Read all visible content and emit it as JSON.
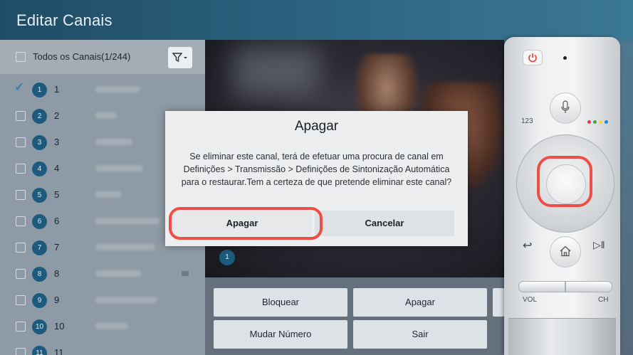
{
  "header": {
    "title": "Editar Canais"
  },
  "channel_list": {
    "all_label": "Todos os Canais(1/244)",
    "filter_icon": "filter-icon",
    "rows": [
      {
        "number": "1",
        "checked": true
      },
      {
        "number": "2",
        "checked": false
      },
      {
        "number": "3",
        "checked": false
      },
      {
        "number": "4",
        "checked": false
      },
      {
        "number": "5",
        "checked": false
      },
      {
        "number": "6",
        "checked": false
      },
      {
        "number": "7",
        "checked": false
      },
      {
        "number": "8",
        "checked": false
      },
      {
        "number": "9",
        "checked": false
      },
      {
        "number": "10",
        "checked": false
      },
      {
        "number": "11",
        "checked": false
      }
    ]
  },
  "video": {
    "channel_badge": "1"
  },
  "actions": {
    "bloquear": "Bloquear",
    "apagar": "Apagar",
    "mudar_numero": "Mudar Número",
    "sair": "Sair"
  },
  "dialog": {
    "title": "Apagar",
    "message": "Se eliminar este canal, terá de efetuar uma procura de canal em Definições > Transmissão > Definições de Sintonização Automática para o restaurar.Tem a certeza de que pretende eliminar este canal?",
    "confirm_label": "Apagar",
    "cancel_label": "Cancelar"
  },
  "remote": {
    "num_label": "123",
    "vol_label": "VOL",
    "ch_label": "CH",
    "highlight_color": "#ef4e47"
  }
}
